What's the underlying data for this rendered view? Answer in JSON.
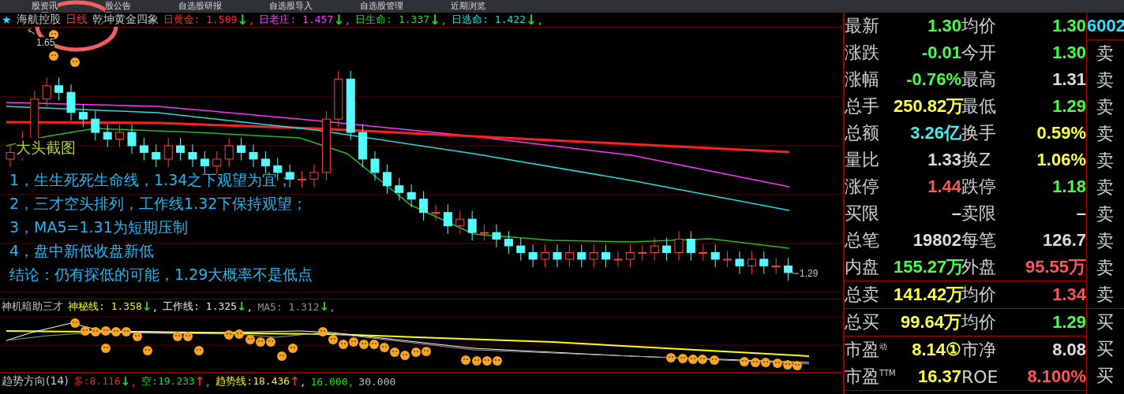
{
  "menu_bar": {
    "items": [
      "股资讯",
      "股公告",
      "自选股研报",
      "自选股导入",
      "自选股管理",
      "近期浏览"
    ]
  },
  "chart_header": {
    "star": "★",
    "stock_name": "海航控股",
    "period": "日线",
    "indicator_name": "乾坤黄金四象",
    "readings": [
      {
        "label": "日黄金:",
        "value": "1.509",
        "arrow": {
          "symbol": "↓",
          "color": "#22dd22"
        },
        "separator": ",",
        "color": "#ff2a2a"
      },
      {
        "label": "日老庄:",
        "value": "1.457",
        "arrow": {
          "symbol": "↓",
          "color": "#22dd22"
        },
        "separator": ",",
        "color": "#ff33ff"
      },
      {
        "label": "日生命:",
        "value": "1.337",
        "arrow": {
          "symbol": "↓",
          "color": "#22dd22"
        },
        "separator": ",",
        "color": "#22dd22"
      },
      {
        "label": "日逃命:",
        "value": "1.422",
        "arrow": {
          "symbol": "↓",
          "color": "#22dd22"
        },
        "separator": ",",
        "color": "#22dddd"
      }
    ]
  },
  "price_labels": [
    {
      "kind": "high",
      "text": "1.65"
    },
    {
      "kind": "low",
      "text": "1.29"
    }
  ],
  "watermark_label": "大头截图",
  "notes": [
    "1，生生死死生命线，1.34之下观望为宜；",
    "2，三才空头排列，工作线1.32下保持观望；",
    "3，MA5=1.31为短期压制",
    "4，盘中新低收盘新低",
    "结论：仍有探低的可能，1.29大概率不是低点"
  ],
  "indicator_header": {
    "name": "神机暗助三才",
    "readings": [
      {
        "label": "神秘线:",
        "value": "1.358",
        "arrow": {
          "symbol": "↓",
          "color": "#22dd22"
        },
        "separator": ",",
        "color": "#f0f020"
      },
      {
        "label": "工作线:",
        "value": "1.325",
        "arrow": {
          "symbol": "↓",
          "color": "#22dd22"
        },
        "separator": ",",
        "color": "#e8e8e8"
      },
      {
        "label": "MA5:",
        "value": "1.312",
        "arrow": {
          "symbol": "↓",
          "color": "#22dd22"
        },
        "separator": ",",
        "color": "#909090"
      }
    ]
  },
  "trend_footer": {
    "name": "趋势方向(14)",
    "readings": [
      {
        "label": "多:",
        "value": "8.116",
        "arrow": {
          "symbol": "↓",
          "color": "#22dd22"
        },
        "separator": ",",
        "color": "#ff2020"
      },
      {
        "label": "空:",
        "value": "19.233",
        "arrow": {
          "symbol": "↑",
          "color": "#ff3030"
        },
        "separator": ",",
        "color": "#22dd22"
      },
      {
        "label": "趋势线:",
        "value": "18.436",
        "arrow": {
          "symbol": "↑",
          "color": "#ff3030"
        },
        "separator": ",",
        "color": "#f0f020"
      },
      {
        "value": "16.000",
        "separator": ",",
        "color": "#22dd22"
      },
      {
        "value": "30.000",
        "color": "#bbbbbb"
      }
    ]
  },
  "quote_sections": [
    {
      "rows": [
        {
          "cells": [
            {
              "label": "最新",
              "value": "1.30",
              "color": "#44ff44"
            },
            {
              "label": "均价",
              "value": "1.30",
              "color": "#44ff44"
            }
          ]
        },
        {
          "cells": [
            {
              "label": "涨跌",
              "value": "-0.01",
              "color": "#44ff44"
            },
            {
              "label": "今开",
              "value": "1.30",
              "color": "#44ff44"
            }
          ]
        },
        {
          "cells": [
            {
              "label": "涨幅",
              "value": "-0.76%",
              "color": "#44ff44"
            },
            {
              "label": "最高",
              "value": "1.31",
              "color": "#dddddd"
            }
          ]
        },
        {
          "cells": [
            {
              "label": "总手",
              "value": "250.82万",
              "color": "#ffff44"
            },
            {
              "label": "最低",
              "value": "1.29",
              "color": "#44ff44"
            }
          ]
        },
        {
          "cells": [
            {
              "label": "总额",
              "value": "3.26亿",
              "color": "#44eeee"
            },
            {
              "label": "换手",
              "value": "0.59%",
              "color": "#ffff44"
            }
          ]
        },
        {
          "cells": [
            {
              "label": "量比",
              "value": "1.33",
              "color": "#dddddd"
            },
            {
              "label": "换Z",
              "value": "1.06%",
              "color": "#ffff44"
            }
          ]
        },
        {
          "cells": [
            {
              "label": "涨停",
              "value": "1.44",
              "color": "#ff5555"
            },
            {
              "label": "跌停",
              "value": "1.18",
              "color": "#44ff44"
            }
          ]
        },
        {
          "cells": [
            {
              "label": "买限",
              "value": "–",
              "color": "#dddddd"
            },
            {
              "label": "卖限",
              "value": "–",
              "color": "#dddddd"
            }
          ]
        },
        {
          "cells": [
            {
              "label": "总笔",
              "value": "19802",
              "color": "#dddddd"
            },
            {
              "label": "每笔",
              "value": "126.7",
              "color": "#dddddd"
            }
          ]
        },
        {
          "cells": [
            {
              "label": "内盘",
              "value": "155.27万",
              "color": "#44ff44"
            },
            {
              "label": "外盘",
              "value": "95.55万",
              "color": "#ff5555"
            }
          ]
        }
      ]
    },
    {
      "rows": [
        {
          "cells": [
            {
              "label": "总卖",
              "value": "141.42万",
              "color": "#ffff44"
            },
            {
              "label": "均价",
              "value": "1.34",
              "color": "#ff5555"
            }
          ]
        }
      ]
    },
    {
      "rows": [
        {
          "cells": [
            {
              "label": "总买",
              "value": "99.64万",
              "color": "#ffff44"
            },
            {
              "label": "均价",
              "value": "1.29",
              "color": "#44ff44"
            }
          ]
        }
      ]
    },
    {
      "rows": [
        {
          "cells": [
            {
              "label": "市盈$^{动}$",
              "value": "8.14①",
              "color": "#ffff44"
            },
            {
              "label": "市净",
              "value": "8.08",
              "color": "#dddddd"
            }
          ]
        },
        {
          "cells": [
            {
              "label": "市盈$^{TTM}$",
              "value": "16.37",
              "color": "#ffff44"
            },
            {
              "label": "ROE",
              "value": "8.100%",
              "color": "#ff5555"
            }
          ]
        }
      ]
    }
  ],
  "order_book": {
    "code": "6002",
    "sell_labels": [
      "卖",
      "卖",
      "卖",
      "卖",
      "卖",
      "卖",
      "卖",
      "卖",
      "卖",
      "卖"
    ],
    "buy_labels": [
      "买",
      "买",
      "买"
    ]
  }
}
